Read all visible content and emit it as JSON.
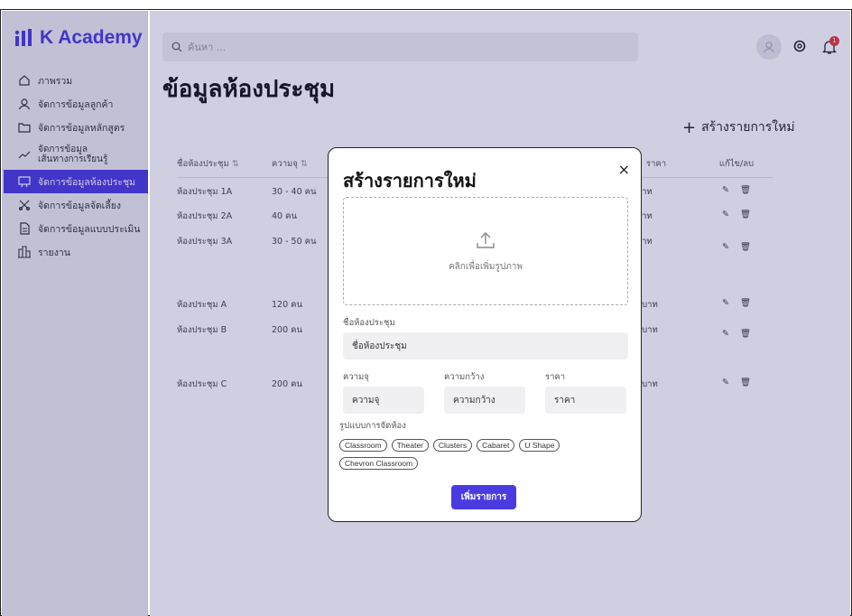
{
  "sidebar": {
    "brand": "K Academy",
    "items": [
      {
        "label": "ภาพรวม",
        "icon": "home-icon"
      },
      {
        "label": "จัดการข้อมูลลูกค้า",
        "icon": "user-icon"
      },
      {
        "label": "จัดการข้อมูลหลักสูตร",
        "icon": "folder-icon"
      },
      {
        "label": "จัดการข้อมูล\nเส้นทางการเรียนรู้",
        "icon": "trend-icon"
      },
      {
        "label": "จัดการข้อมูลห้องประชุม",
        "icon": "presentation-icon"
      },
      {
        "label": "จัดการข้อมูลจัดเลี้ยง",
        "icon": "catering-icon"
      },
      {
        "label": "จัดการข้อมูลแบบประเมิน",
        "icon": "document-icon"
      },
      {
        "label": "รายงาน",
        "icon": "report-icon"
      }
    ],
    "active_index": 4
  },
  "header": {
    "search_placeholder": "ค้นหา ...",
    "notification_count": "1"
  },
  "page": {
    "title": "ข้อมูลห้องประชุม",
    "create_label": "สร้างรายการใหม่"
  },
  "table": {
    "columns": [
      "ชื่อห้องประชุม",
      "ความจุ",
      "ราคา",
      "แก้ไข/ลบ"
    ],
    "rows": [
      {
        "name": "ห้องประชุม 1A",
        "capacity": "30 - 40 คน",
        "price": "0 บาท"
      },
      {
        "name": "ห้องประชุม 2A",
        "capacity": "40 คน",
        "price": "0 บาท"
      },
      {
        "name": "ห้องประชุม 3A",
        "capacity": "30 - 50 คน",
        "price": "0 บาท"
      },
      {
        "name": "ห้องประชุม A",
        "capacity": "120 คน",
        "price": "00 บาท"
      },
      {
        "name": "ห้องประชุม B",
        "capacity": "200 คน",
        "price": "00 บาท"
      },
      {
        "name": "ห้องประชุม C",
        "capacity": "200 คน",
        "price": "00 บาท"
      }
    ]
  },
  "modal": {
    "title": "สร้างรายการใหม่",
    "close": "×",
    "upload_label": "คลิกเพื่อเพิ่มรูปภาพ",
    "name_label": "ชื่อห้องประชุม",
    "name_placeholder": "ชื่อห้องประชุม",
    "capacity_label": "ความจุ",
    "capacity_placeholder": "ความจุ",
    "width_label": "ความกว้าง",
    "width_placeholder": "ความกว้าง",
    "price_label": "ราคา",
    "price_placeholder": "ราคา",
    "layout_label": "รูปแบบการจัดห้อง",
    "layouts": [
      "Classroom",
      "Theater",
      "Clusters",
      "Cabaret",
      "U Shape",
      "Chevron Classroom"
    ],
    "submit_label": "เพิ่มรายการ"
  },
  "colors": {
    "brand": "#4a3be0",
    "notification": "#e53935"
  }
}
